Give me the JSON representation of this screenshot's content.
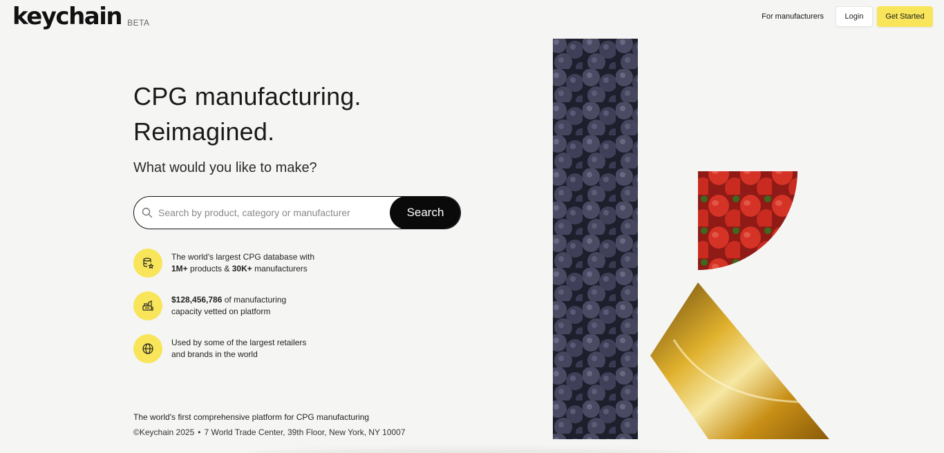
{
  "header": {
    "logo": "keychain",
    "badge": "BETA",
    "nav_manufacturers": "For manufacturers",
    "login": "Login",
    "get_started": "Get Started"
  },
  "hero": {
    "headline_line1": "CPG manufacturing.",
    "headline_line2": "Reimagined.",
    "subhead": "What would you like to make?",
    "search_placeholder": "Search by product, category or manufacturer",
    "search_value": "",
    "search_button": "Search"
  },
  "features": [
    {
      "pre": "The world's largest CPG database with",
      "bold1": "1M+",
      "mid": " products & ",
      "bold2": "30K+",
      "post": " manufacturers",
      "icon": "database-icon"
    },
    {
      "bold": "$128,456,786",
      "line1_rest": " of manufacturing",
      "line2": "capacity vetted on platform",
      "icon": "factory-icon"
    },
    {
      "line1": "Used by some of the largest retailers",
      "line2": "and brands in the world",
      "icon": "globe-icon"
    }
  ],
  "footer": {
    "tagline": "The world's first comprehensive platform for CPG manufacturing",
    "copyright": "©Keychain 2025",
    "address": "7 World Trade Center, 39th Floor, New York, NY 10007"
  },
  "colors": {
    "accent": "#f8e55a",
    "background": "#f5f5f3",
    "search_button": "#0a0a0a"
  }
}
